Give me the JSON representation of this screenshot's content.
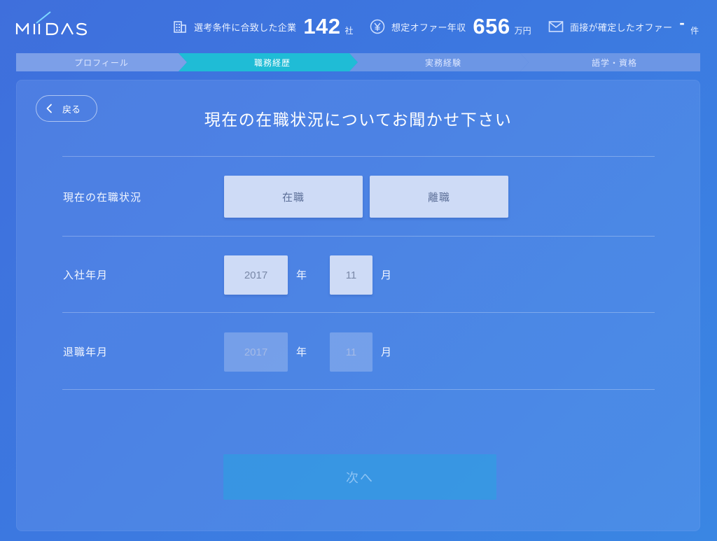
{
  "brand": {
    "logo_text": "MIIDAS",
    "accent_color": "#7fd8ff"
  },
  "header_stats": {
    "companies": {
      "icon": "building-icon",
      "label": "選考条件に合致した企業",
      "value": "142",
      "unit": "社"
    },
    "salary": {
      "icon": "yen-icon",
      "label": "想定オファー年収",
      "value": "656",
      "unit": "万円"
    },
    "interviews": {
      "icon": "mail-icon",
      "label": "面接が確定したオファー",
      "value": "-",
      "unit": "件"
    }
  },
  "steps": [
    {
      "label": "プロフィール",
      "state": "done"
    },
    {
      "label": "職務経歴",
      "state": "current"
    },
    {
      "label": "実務経験",
      "state": "todo"
    },
    {
      "label": "語学・資格",
      "state": "todo"
    }
  ],
  "back_button": {
    "label": "戻る",
    "icon": "chevron-left-icon"
  },
  "page_title": "現在の在職状況についてお聞かせ下さい",
  "form": {
    "status": {
      "label": "現在の在職状況",
      "options": [
        "在職",
        "離職"
      ]
    },
    "join_date": {
      "label": "入社年月",
      "year": "2017",
      "year_unit": "年",
      "month": "11",
      "month_unit": "月"
    },
    "leave_date": {
      "label": "退職年月",
      "year": "2017",
      "year_unit": "年",
      "month": "11",
      "month_unit": "月",
      "disabled": true
    }
  },
  "next_button": {
    "label": "次へ",
    "disabled": true
  }
}
